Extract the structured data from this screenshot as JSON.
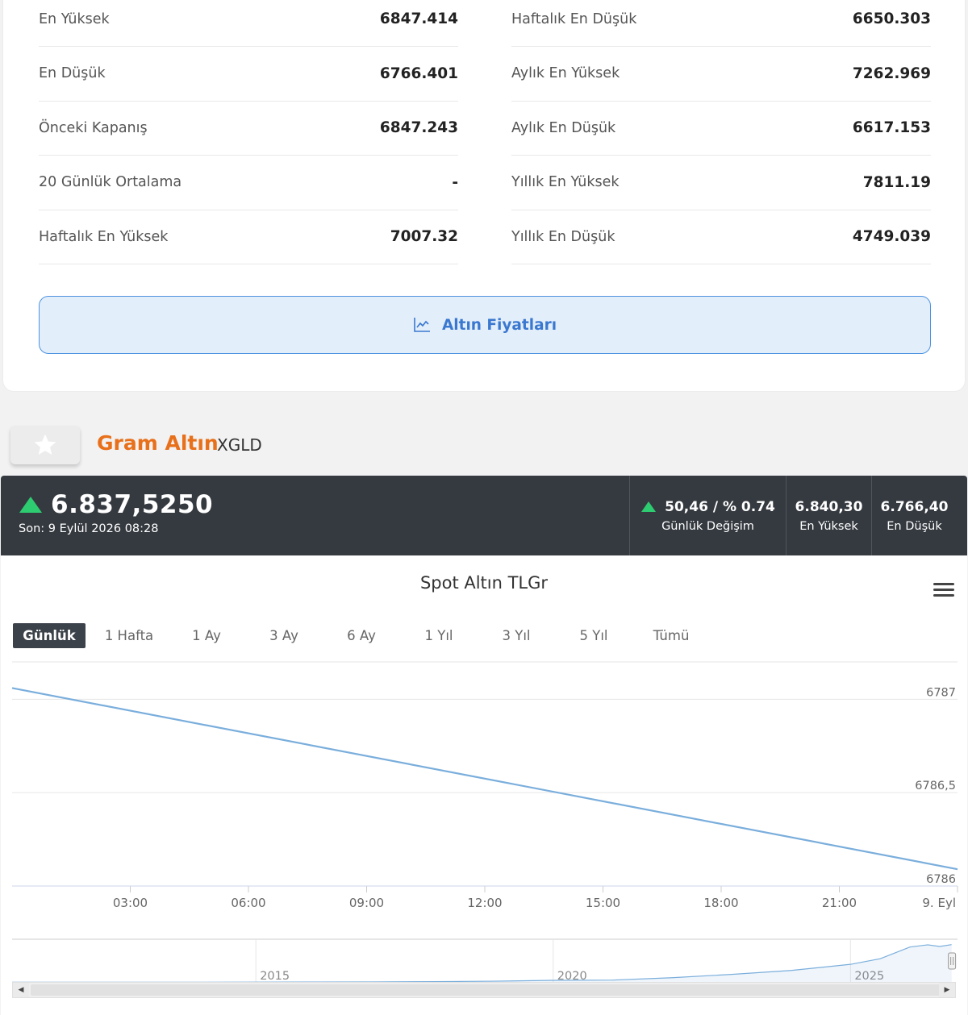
{
  "stats": {
    "left": [
      {
        "label": "En Yüksek",
        "value": "6847.414"
      },
      {
        "label": "En Düşük",
        "value": "6766.401"
      },
      {
        "label": "Önceki Kapanış",
        "value": "6847.243"
      },
      {
        "label": "20 Günlük Ortalama",
        "value": "-"
      },
      {
        "label": "Haftalık En Yüksek",
        "value": "7007.32"
      }
    ],
    "right": [
      {
        "label": "Haftalık En Düşük",
        "value": "6650.303"
      },
      {
        "label": "Aylık En Yüksek",
        "value": "7262.969"
      },
      {
        "label": "Aylık En Düşük",
        "value": "6617.153"
      },
      {
        "label": "Yıllık En Yüksek",
        "value": "7811.19"
      },
      {
        "label": "Yıllık En Düşük",
        "value": "4749.039"
      }
    ],
    "cta_label": "Altın Fiyatları",
    "cta_icon": "line-chart-icon"
  },
  "instrument": {
    "name": "Gram Altın",
    "code": "XGLD",
    "fav_icon": "star-icon"
  },
  "price_bar": {
    "price": "6.837,5250",
    "last_update": "Son: 9 Eylül 2026 08:28",
    "change_value": "50,46 / % 0.74",
    "change_label": "Günlük Değişim",
    "high_value": "6.840,30",
    "high_label": "En Yüksek",
    "low_value": "6.766,40",
    "low_label": "En Düşük",
    "up_color": "#2ecc71"
  },
  "chart": {
    "title": "Spot Altın TLGr",
    "range_tabs": [
      "Günlük",
      "1 Hafta",
      "1 Ay",
      "3 Ay",
      "6 Ay",
      "1 Yıl",
      "3 Yıl",
      "5 Yıl",
      "Tümü"
    ],
    "active_tab": "Günlük",
    "line_color": "#7aaedc"
  },
  "chart_data": [
    {
      "type": "line",
      "title": "Spot Altın TLGr",
      "x_ticks": [
        "03:00",
        "06:00",
        "09:00",
        "12:00",
        "15:00",
        "18:00",
        "21:00",
        "9. Eyl"
      ],
      "y_ticks": [
        "6787",
        "6786,5",
        "6786"
      ],
      "x_hours": [
        0,
        24
      ],
      "series": [
        {
          "x": [
            0,
            24
          ],
          "y": [
            6787.06,
            6786.09
          ]
        }
      ],
      "xlim": [
        0,
        24
      ],
      "ylim": [
        6786,
        6787.2
      ],
      "grid": true
    },
    {
      "type": "area",
      "x_ticks": [
        "2015",
        "2020",
        "2025"
      ],
      "series": [
        {
          "x": [
            2010.9,
            2012,
            2013,
            2014,
            2015,
            2016,
            2017,
            2018,
            2019,
            2020,
            2021,
            2022,
            2023,
            2024,
            2025,
            2025.5,
            2026,
            2026.3,
            2026.5,
            2026.7
          ],
          "y": [
            90,
            95,
            85,
            90,
            110,
            130,
            150,
            200,
            280,
            430,
            480,
            900,
            1500,
            2200,
            3300,
            4300,
            6400,
            6800,
            6500,
            6837
          ]
        }
      ],
      "xlim": [
        2010.9,
        2026.8
      ],
      "ylim": [
        0,
        7800
      ]
    }
  ]
}
